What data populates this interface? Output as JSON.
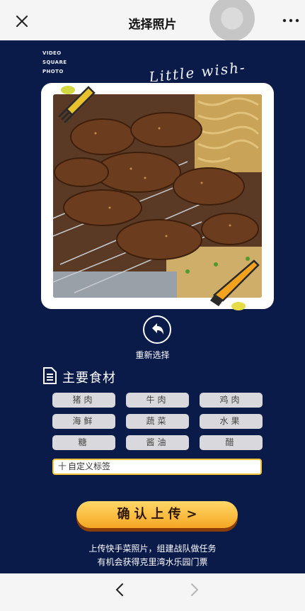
{
  "topbar": {
    "title": "选择照片"
  },
  "hero": {
    "stamp_lines": [
      "VIDEO",
      "SQUARE",
      "PHOTO"
    ],
    "script_text": "Little wish-"
  },
  "reselect": {
    "label": "重新选择"
  },
  "ingredients": {
    "title": "主要食材",
    "tags": [
      "猪肉",
      "牛肉",
      "鸡肉",
      "海鲜",
      "蔬菜",
      "水果",
      "糖",
      "酱油",
      "醋"
    ],
    "custom_tag": {
      "plus": "十",
      "label": "自定义标签"
    }
  },
  "confirm": {
    "label": "确认上传",
    "chevron": ">"
  },
  "note": {
    "line1": "上传快手菜照片，组建战队做任务",
    "line2": "有机会获得克里湾水乐园门票"
  },
  "colors": {
    "background": "#0a1b4a",
    "button": "#f5a623",
    "accent_border": "#f3c33a",
    "tag_bg": "#d9d9dd"
  },
  "icons": {
    "close": "close-icon",
    "more": "more-icon",
    "reselect": "undo-arrow-icon",
    "list": "document-list-icon",
    "back": "chevron-left-icon",
    "forward": "chevron-right-icon"
  }
}
